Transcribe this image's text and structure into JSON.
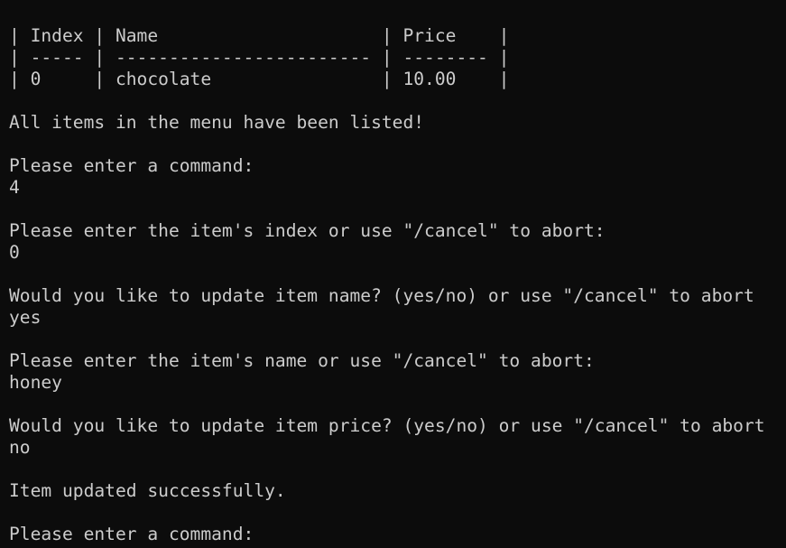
{
  "terminal": {
    "lines": [
      "| Index | Name                     | Price    |",
      "| ----- | ------------------------ | -------- |",
      "| 0     | chocolate                | 10.00    |",
      "",
      "All items in the menu have been listed!",
      "",
      "Please enter a command:",
      "4",
      "",
      "Please enter the item's index or use \"/cancel\" to abort:",
      "0",
      "",
      "Would you like to update item name? (yes/no) or use \"/cancel\" to abort",
      "yes",
      "",
      "Please enter the item's name or use \"/cancel\" to abort:",
      "honey",
      "",
      "Would you like to update item price? (yes/no) or use \"/cancel\" to abort",
      "no",
      "",
      "Item updated successfully.",
      "",
      "Please enter a command:"
    ]
  }
}
